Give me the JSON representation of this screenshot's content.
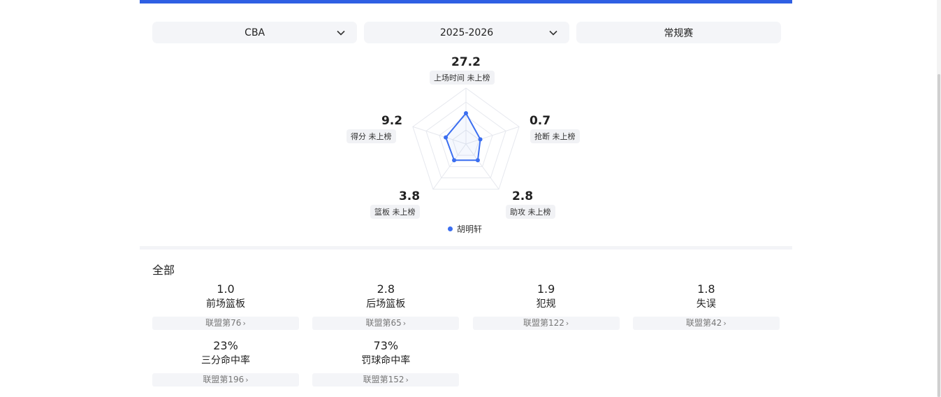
{
  "filters": {
    "league": "CBA",
    "season": "2025-2026",
    "stage": "常规赛"
  },
  "radar": {
    "player": "胡明轩",
    "color": "#3b6ef0",
    "stats": [
      {
        "value": "27.2",
        "tag": "上场时间 未上榜",
        "ratio": 0.55
      },
      {
        "value": "0.7",
        "tag": "抢断 未上榜",
        "ratio": 0.27
      },
      {
        "value": "2.8",
        "tag": "助攻 未上榜",
        "ratio": 0.36
      },
      {
        "value": "3.8",
        "tag": "篮板 未上榜",
        "ratio": 0.36
      },
      {
        "value": "9.2",
        "tag": "得分 未上榜",
        "ratio": 0.38
      }
    ]
  },
  "section": {
    "title": "全部"
  },
  "cells": [
    {
      "value": "1.0",
      "label": "前场篮板",
      "rank": "联盟第76"
    },
    {
      "value": "2.8",
      "label": "后场篮板",
      "rank": "联盟第65"
    },
    {
      "value": "1.9",
      "label": "犯规",
      "rank": "联盟第122"
    },
    {
      "value": "1.8",
      "label": "失误",
      "rank": "联盟第42"
    },
    {
      "value": "23%",
      "label": "三分命中率",
      "rank": "联盟第196"
    },
    {
      "value": "73%",
      "label": "罚球命中率",
      "rank": "联盟第152"
    }
  ]
}
